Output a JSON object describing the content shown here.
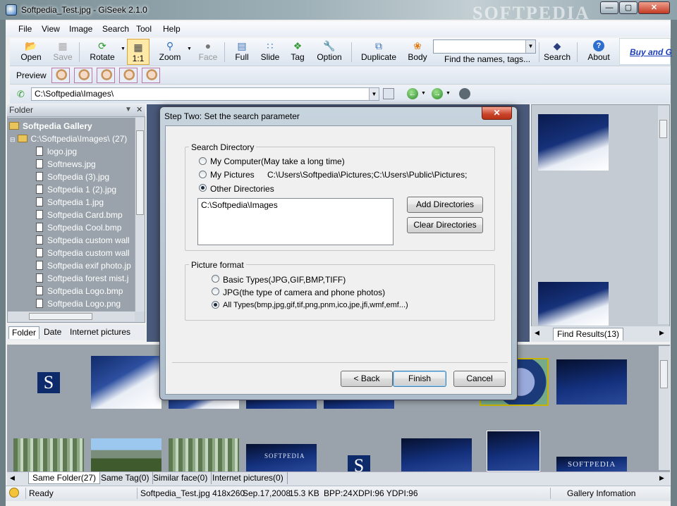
{
  "window": {
    "title": "Softpedia_Test.jpg - GiSeek 2.1.0",
    "minimize": "0",
    "maximize": "1",
    "close": "r",
    "watermark": "SOFTPEDIA"
  },
  "menu": [
    "File",
    "View",
    "Image",
    "Search",
    "Tool",
    "Help"
  ],
  "toolbar": {
    "open": "Open",
    "save": "Save",
    "rotate": "Rotate",
    "one_to_one": "1:1",
    "zoom": "Zoom",
    "face": "Face",
    "full": "Full",
    "slide": "Slide",
    "tag": "Tag",
    "option": "Option",
    "duplicate": "Duplicate",
    "body": "Body",
    "find_label": "Find the names, tags...",
    "search": "Search",
    "about": "About",
    "buy": "Buy and G"
  },
  "preview": {
    "label": "Preview"
  },
  "address": {
    "path": "C:\\Softpedia\\Images\\"
  },
  "folder_pane": {
    "header": "Folder",
    "root": "Softpedia Gallery",
    "subfolder": "C:\\Softpedia\\Images\\ (27)",
    "files": [
      "logo.jpg",
      "Softnews.jpg",
      "Softpedia (3).jpg",
      "Softpedia 1 (2).jpg",
      "Softpedia 1.jpg",
      "Softpedia Card.bmp",
      "Softpedia Cool.bmp",
      "Softpedia custom wall",
      "Softpedia custom wall",
      "Softpedia exif photo.jp",
      "Softpedia forest mist.j",
      "Softpedia Logo.bmp",
      "Softpedia Logo.png"
    ],
    "tabs": [
      "Folder",
      "Date",
      "Internet pictures"
    ]
  },
  "results_pane": {
    "tab": "Find Results(13)"
  },
  "gallery": {
    "tabs": [
      "Same Folder(27)",
      "Same Tag(0)",
      "Similar face(0)",
      "Internet pictures(0)"
    ],
    "logo_text": "S",
    "softpedia_text": "SOFTPEDIA"
  },
  "status": {
    "ready": "Ready",
    "file": "Softpedia_Test.jpg 418x260",
    "date": "Sep.17,2008",
    "size": "15.3 KB",
    "bpp": "BPP:24",
    "dpi": "XDPI:96 YDPI:96",
    "gallery_info": "Gallery Infomation"
  },
  "dialog": {
    "title": "Step Two: Set the search parameter",
    "close": "x",
    "search_dir_group": "Search Directory",
    "opt_my_computer": "My Computer(May take a long time)",
    "opt_my_pictures": "My Pictures",
    "my_pictures_path": "C:\\Users\\Softpedia\\Pictures;C:\\Users\\Public\\Pictures;",
    "opt_other_dirs": "Other Directories",
    "dir_list": "C:\\Softpedia\\Images",
    "add_dirs": "Add Directories",
    "clear_dirs": "Clear Directories",
    "format_group": "Picture format",
    "fmt_basic": "Basic Types(JPG,GIF,BMP,TIFF)",
    "fmt_jpg": "JPG(the type of camera and phone photos)",
    "fmt_all": "All Types(bmp,jpg,gif,tif,png,pnm,ico,jpe,jfi,wmf,emf...)",
    "back": "< Back",
    "finish": "Finish",
    "cancel": "Cancel",
    "selected_dir_option": "Other Directories",
    "selected_format": "All Types"
  }
}
